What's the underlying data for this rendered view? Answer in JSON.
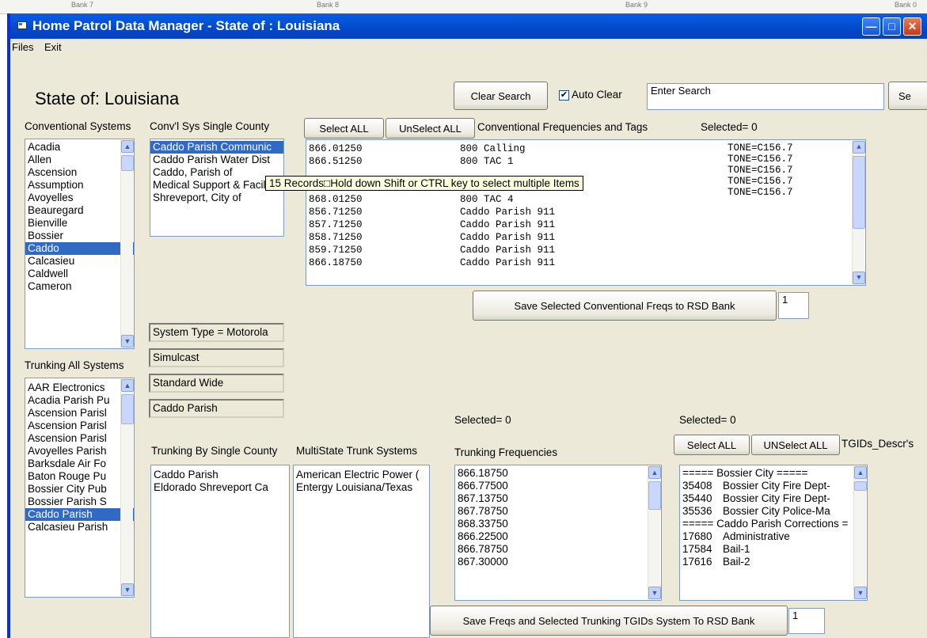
{
  "window": {
    "title": "Home Patrol Data Manager - State of : Louisiana",
    "topstrip": [
      "Bank 7",
      "Bank 8",
      "Bank 9",
      "Bank 0"
    ]
  },
  "menu": {
    "files": "Files",
    "exit": "Exit"
  },
  "header": {
    "state_title": "State of: Louisiana",
    "clear_search": "Clear Search",
    "auto_clear_label": "Auto Clear",
    "auto_clear_checked": true,
    "search_value": "Enter Search",
    "search_button": "Se"
  },
  "conventional": {
    "systems_label": "Conventional Systems",
    "systems": [
      "Acadia",
      "Allen",
      "Ascension",
      "Assumption",
      "Avoyelles",
      "Beauregard",
      "Bienville",
      "Bossier",
      "Caddo",
      "Calcasieu",
      "Caldwell",
      "Cameron"
    ],
    "systems_selected": 8,
    "single_county_label": "Conv'l Sys Single County",
    "single_county": [
      "Caddo Parish Communic",
      "Caddo Parish Water Dist",
      "Caddo, Parish of",
      "Medical Support & Facili",
      "Shreveport, City of"
    ],
    "single_county_selected": 0,
    "select_all": "Select ALL",
    "unselect_all": "UnSelect ALL",
    "freqs_label": "Conventional Frequencies and Tags",
    "selected_count": "Selected= 0",
    "freqs": [
      {
        "freq": "866.01250",
        "tag": "800 Calling"
      },
      {
        "freq": "866.51250",
        "tag": "800 TAC 1"
      },
      {
        "freq": "",
        "tag": ""
      },
      {
        "freq": "",
        "tag": ""
      },
      {
        "freq": "868.01250",
        "tag": "800 TAC 4"
      },
      {
        "freq": "856.71250",
        "tag": "Caddo Parish 911"
      },
      {
        "freq": "857.71250",
        "tag": "Caddo Parish 911"
      },
      {
        "freq": "858.71250",
        "tag": "Caddo Parish 911"
      },
      {
        "freq": "859.71250",
        "tag": "Caddo Parish 911"
      },
      {
        "freq": "866.18750",
        "tag": "Caddo Parish 911"
      }
    ],
    "tones": [
      "TONE=C156.7",
      "TONE=C156.7",
      "TONE=C156.7",
      "TONE=C156.7",
      "TONE=C156.7"
    ],
    "tooltip": "15 Records□Hold down Shift or CTRL key to select multiple Items",
    "save_button": "Save Selected Conventional Freqs to RSD Bank",
    "bank_value": "1"
  },
  "system_info": [
    "System Type = Motorola",
    "Simulcast",
    "Standard Wide",
    "Caddo Parish"
  ],
  "trunking": {
    "all_label": "Trunking All Systems",
    "all": [
      "AAR Electronics",
      "Acadia Parish Pu",
      "Ascension Parisl",
      "Ascension Parisl",
      "Ascension Parisl",
      "Avoyelles Parish",
      "Barksdale Air Fo",
      "Baton Rouge Pu",
      "Bossier City Pub",
      "Bossier Parish S",
      "Caddo Parish",
      "Calcasieu Parish"
    ],
    "all_selected": 10,
    "single_county_label": "Trunking By Single County",
    "single_county": [
      "Caddo Parish",
      "Eldorado Shreveport Ca"
    ],
    "multistate_label": "MultiState Trunk Systems",
    "multistate": [
      "American Electric Power (",
      "Entergy Louisiana/Texas"
    ],
    "selected_count": "Selected= 0",
    "freqs_label": "Trunking Frequencies",
    "freqs": [
      "866.18750",
      "866.77500",
      "867.13750",
      "867.78750",
      "868.33750",
      "866.22500",
      "866.78750",
      "867.30000"
    ],
    "tgids_selected": "Selected= 0",
    "select_all": "Select ALL",
    "unselect_all": "UNSelect ALL",
    "tgids_label": "TGIDs_Descr's",
    "tgids": [
      {
        "id": "===== Bossier City =====",
        "desc": "",
        "header": true
      },
      {
        "id": "35408",
        "desc": "Bossier City Fire Dept-",
        "header": false
      },
      {
        "id": "35440",
        "desc": "Bossier City Fire Dept-",
        "header": false
      },
      {
        "id": "35536",
        "desc": "Bossier City Police-Ma",
        "header": false
      },
      {
        "id": "===== Caddo Parish Corrections =",
        "desc": "",
        "header": true
      },
      {
        "id": "17680",
        "desc": "Administrative",
        "header": false
      },
      {
        "id": "17584",
        "desc": "Bail-1",
        "header": false
      },
      {
        "id": "17616",
        "desc": "Bail-2",
        "header": false
      }
    ],
    "save_button": "Save Freqs and Selected Trunking TGIDs  System To RSD Bank",
    "bank_value": "1"
  }
}
